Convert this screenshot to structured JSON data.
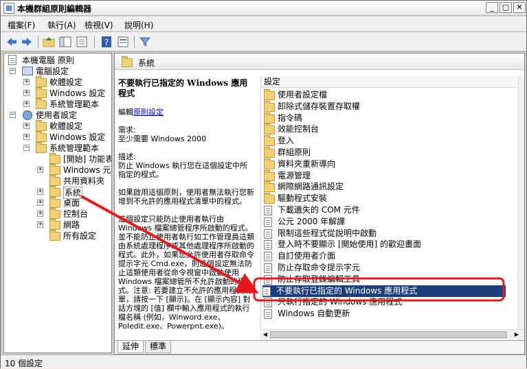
{
  "window": {
    "title": "本機群組原則編輯器"
  },
  "menu": [
    {
      "label": "檔案(F)"
    },
    {
      "label": "執行(A)"
    },
    {
      "label": "檢視(V)"
    },
    {
      "label": "說明(H)"
    }
  ],
  "toolbar": {
    "icons": [
      "back-icon",
      "forward-icon",
      "up-icon",
      "show-hide-tree-icon",
      "export-list-icon",
      "help-icon",
      "properties-icon",
      "filter-icon"
    ]
  },
  "tree": {
    "root": "本機電腦 原則",
    "computer_config": "電腦設定",
    "cc_software": "軟體設定",
    "cc_windows": "Windows 設定",
    "cc_admin": "系統管理範本",
    "user_config": "使用者設定",
    "uc_software": "軟體設定",
    "uc_windows": "Windows 設定",
    "uc_admin": "系統管理範本",
    "start_menu": "[開始] 功能表",
    "win_components": "Windows 元件",
    "shared_folders": "共用資料夾",
    "system": "系統",
    "desktop": "桌面",
    "control_panel": "控制台",
    "network": "網路",
    "all_settings": "所有設定"
  },
  "pane": {
    "header": "系統",
    "list_header": "設定",
    "description": {
      "title": "不要執行已指定的 Windows 應用程式",
      "edit_prefix": "編輯",
      "edit_link": "原則設定",
      "requirement_label": "需求:",
      "requirement_value": "至少需要 Windows 2000",
      "desc_label": "描述:",
      "desc_text": "防止 Windows 執行您在這個設定中所指定的程式。",
      "p1": "如果啟用這個原則，使用者無法執行您新增到不允許的應用程式清單中的程式。",
      "p2": "這個設定只能防止使用者執行由 Windows 檔案總管程序所啟動的程式。並不能防止使用者執行如工作管理員這類由系統處理程序或其他處理程序所啟動的程式。此外，如果您允許使用者存取命令提示字元 Cmd.exe，則這個設定無法防止這類使用者從命令視窗中啟動使用 Windows 檔案總管所不允許啟動的程式。注意: 若要建立不允許的應用程式清單，請按一下 [顯示]。在 [顯示內容] 對話方塊的 [值] 欄中輸入應用程式的執行檔名稱 (例如，Winword.exe、Poledit.exe、Powerpnt.exe)。"
    },
    "items": [
      {
        "type": "folder",
        "label": "使用者設定檔"
      },
      {
        "type": "folder",
        "label": "卸除式儲存裝置存取權"
      },
      {
        "type": "folder",
        "label": "指令碼"
      },
      {
        "type": "folder",
        "label": "效能控制台"
      },
      {
        "type": "folder",
        "label": "登入"
      },
      {
        "type": "folder",
        "label": "群組原則"
      },
      {
        "type": "folder",
        "label": "資料夾重新導向"
      },
      {
        "type": "folder",
        "label": "電源管理"
      },
      {
        "type": "folder",
        "label": "網際網路通訊設定"
      },
      {
        "type": "folder",
        "label": "驅動程式安裝"
      },
      {
        "type": "policy",
        "label": "下載遺失的 COM 元件"
      },
      {
        "type": "policy",
        "label": "公元 2000 年解譯"
      },
      {
        "type": "policy",
        "label": "限制這些程式從說明中啟動"
      },
      {
        "type": "policy",
        "label": "登入時不要顯示 [開始使用] 的歡迎畫面"
      },
      {
        "type": "policy",
        "label": "自訂使用者介面"
      },
      {
        "type": "policy",
        "label": "防止存取命令提示字元"
      },
      {
        "type": "policy",
        "label": "防止存取登錄編輯工具"
      },
      {
        "type": "policy",
        "label": "不要執行已指定的 Windows 應用程式",
        "selected": true
      },
      {
        "type": "policy",
        "label": "只執行指定的 Windows 應用程式"
      },
      {
        "type": "policy",
        "label": "Windows 自動更新"
      }
    ],
    "tab_extended": "延伸",
    "tab_standard": "標準"
  },
  "status": {
    "text": "10 個設定"
  },
  "colors": {
    "selection": "#1b3f7a",
    "annotation": "#e8191d"
  }
}
